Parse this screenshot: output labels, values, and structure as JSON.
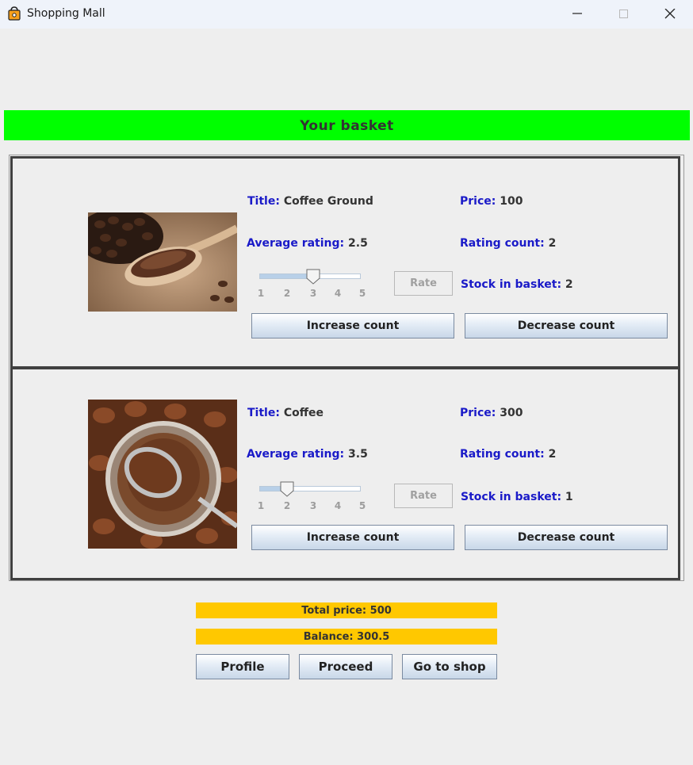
{
  "window": {
    "title": "Shopping Mall"
  },
  "banner": {
    "text": "Your basket"
  },
  "labels": {
    "title": "Title:",
    "price": "Price:",
    "average_rating": "Average rating:",
    "rating_count": "Rating count:",
    "stock_in_basket": "Stock in basket:",
    "rate": "Rate",
    "increase": "Increase count",
    "decrease": "Decrease count"
  },
  "slider_ticks": [
    "1",
    "2",
    "3",
    "4",
    "5"
  ],
  "items": [
    {
      "title": "Coffee Ground",
      "price": "100",
      "average_rating": "2.5",
      "rating_count": "2",
      "stock_in_basket": "2",
      "slider_value": 3
    },
    {
      "title": "Coffee",
      "price": "300",
      "average_rating": "3.5",
      "rating_count": "2",
      "stock_in_basket": "1",
      "slider_value": 2
    }
  ],
  "summary": {
    "total_price": "Total price: 500",
    "balance": "Balance: 300.5"
  },
  "actions": {
    "profile": "Profile",
    "proceed": "Proceed",
    "go_to_shop": "Go to shop"
  },
  "colors": {
    "banner": "#00ff00",
    "summary_bar": "#ffc800",
    "label_key": "#1a1ac8"
  }
}
